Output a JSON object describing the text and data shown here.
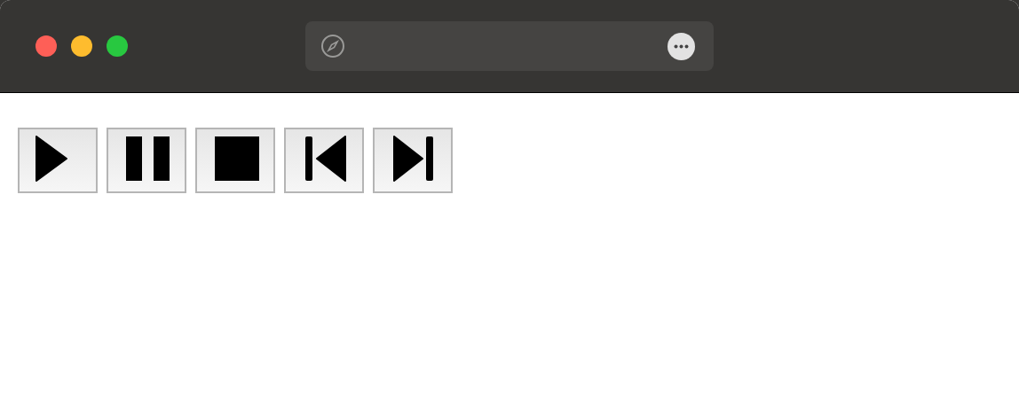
{
  "toolbar": {
    "buttons": [
      {
        "kind": "play"
      },
      {
        "kind": "pause"
      },
      {
        "kind": "stop"
      },
      {
        "kind": "previous"
      },
      {
        "kind": "next"
      }
    ]
  }
}
